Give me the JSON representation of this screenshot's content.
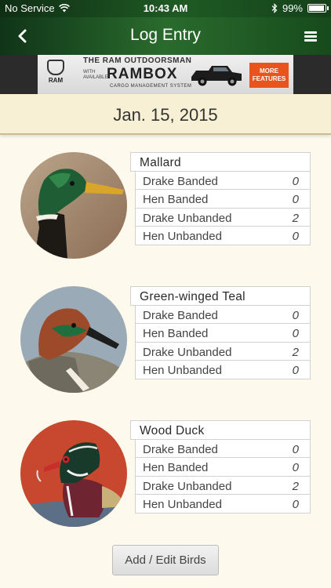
{
  "status_bar": {
    "carrier": "No Service",
    "time": "10:43 AM",
    "battery": "99%",
    "battery_level": 0.99
  },
  "nav": {
    "title": "Log Entry",
    "back_icon": "chevron-left-icon",
    "menu_icon": "hamburger-menu-icon"
  },
  "ad": {
    "line1": "THE RAM OUTDOORSMAN",
    "line2": "WITH AVAILABLE",
    "line3": "RAMBOX",
    "line4": "CARGO MANAGEMENT SYSTEM",
    "brand": "RAM",
    "cta": "MORE FEATURES"
  },
  "date": "Jan. 15, 2015",
  "entries": [
    {
      "species": "Mallard",
      "rows": [
        {
          "label": "Drake Banded",
          "value": "0"
        },
        {
          "label": "Hen Banded",
          "value": "0"
        },
        {
          "label": "Drake Unbanded",
          "value": "2"
        },
        {
          "label": "Hen Unbanded",
          "value": "0"
        }
      ]
    },
    {
      "species": "Green-winged Teal",
      "rows": [
        {
          "label": "Drake Banded",
          "value": "0"
        },
        {
          "label": "Hen Banded",
          "value": "0"
        },
        {
          "label": "Drake Unbanded",
          "value": "2"
        },
        {
          "label": "Hen Unbanded",
          "value": "0"
        }
      ]
    },
    {
      "species": "Wood Duck",
      "rows": [
        {
          "label": "Drake Banded",
          "value": "0"
        },
        {
          "label": "Hen Banded",
          "value": "0"
        },
        {
          "label": "Drake Unbanded",
          "value": "2"
        },
        {
          "label": "Hen Unbanded",
          "value": "0"
        }
      ]
    }
  ],
  "button": {
    "label": "Add / Edit Birds"
  },
  "colors": {
    "nav_green": "#1f5a24",
    "background": "#fdf9ec",
    "date_bar": "#f7f0d4",
    "ad_cta": "#e8541c"
  }
}
